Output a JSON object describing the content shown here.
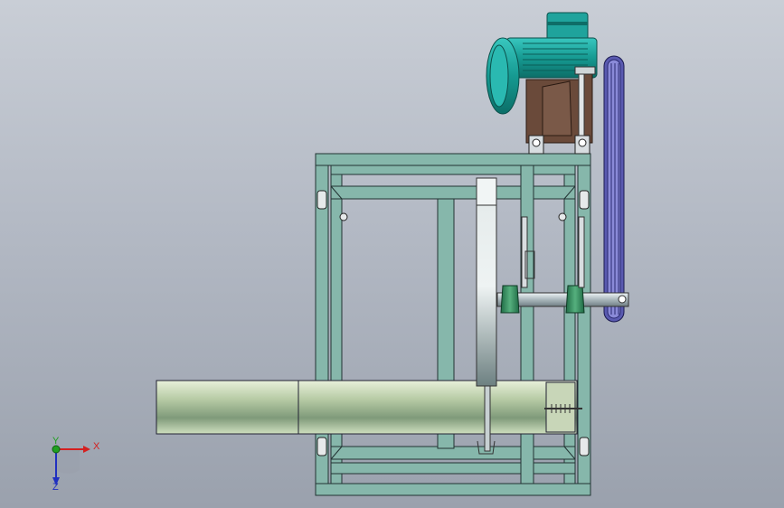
{
  "viewport": {
    "background_top": "#c9ced6",
    "background_bottom": "#9aa1ad"
  },
  "colors": {
    "frame": "#7fb3a8",
    "motor": "#1fa39c",
    "bracket": "#6a4a3a",
    "belt": "#5a5ab0",
    "pipe": "#b8cfa8",
    "shaft": "#c8d4d8",
    "bearing": "#2f8a5a",
    "blade": "#d8dfe0"
  },
  "triad": {
    "x_label": "X",
    "y_label": "Y",
    "z_label": "Z",
    "x_color": "#d42020",
    "y_color": "#20a020",
    "z_color": "#2030c0"
  }
}
